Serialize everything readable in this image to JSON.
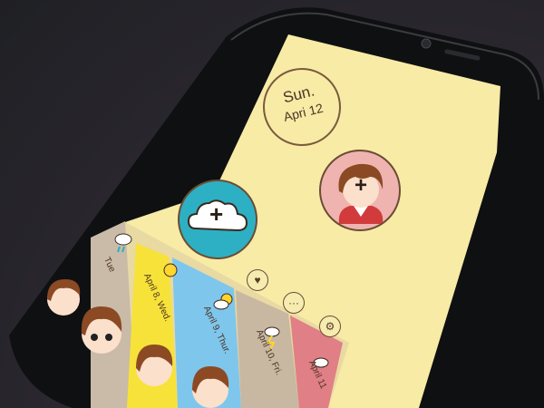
{
  "app": {
    "date_badge": {
      "weekday": "Sun.",
      "date": "Apri 12"
    },
    "add_weather_label": "+",
    "add_avatar_label": "+"
  },
  "timeline": {
    "strips": [
      {
        "label": "Tue",
        "color": "#c9bba7"
      },
      {
        "label": "April 8, Wed.",
        "color": "#f7e23a"
      },
      {
        "label": "April 9, Thur.",
        "color": "#7fc6ec"
      },
      {
        "label": "April 10, Fri.",
        "color": "#c8b8a2"
      },
      {
        "label": "April 11",
        "color": "#e07f86"
      }
    ]
  },
  "toolbar": {
    "like_icon": "heart-icon",
    "more_label": "···",
    "settings_icon": "gear-icon"
  },
  "colors": {
    "screen_bg": "#f7eba6",
    "accent_teal": "#2db0c4",
    "avatar_pink": "#efb4b0",
    "outline_brown": "#6b4c33"
  }
}
